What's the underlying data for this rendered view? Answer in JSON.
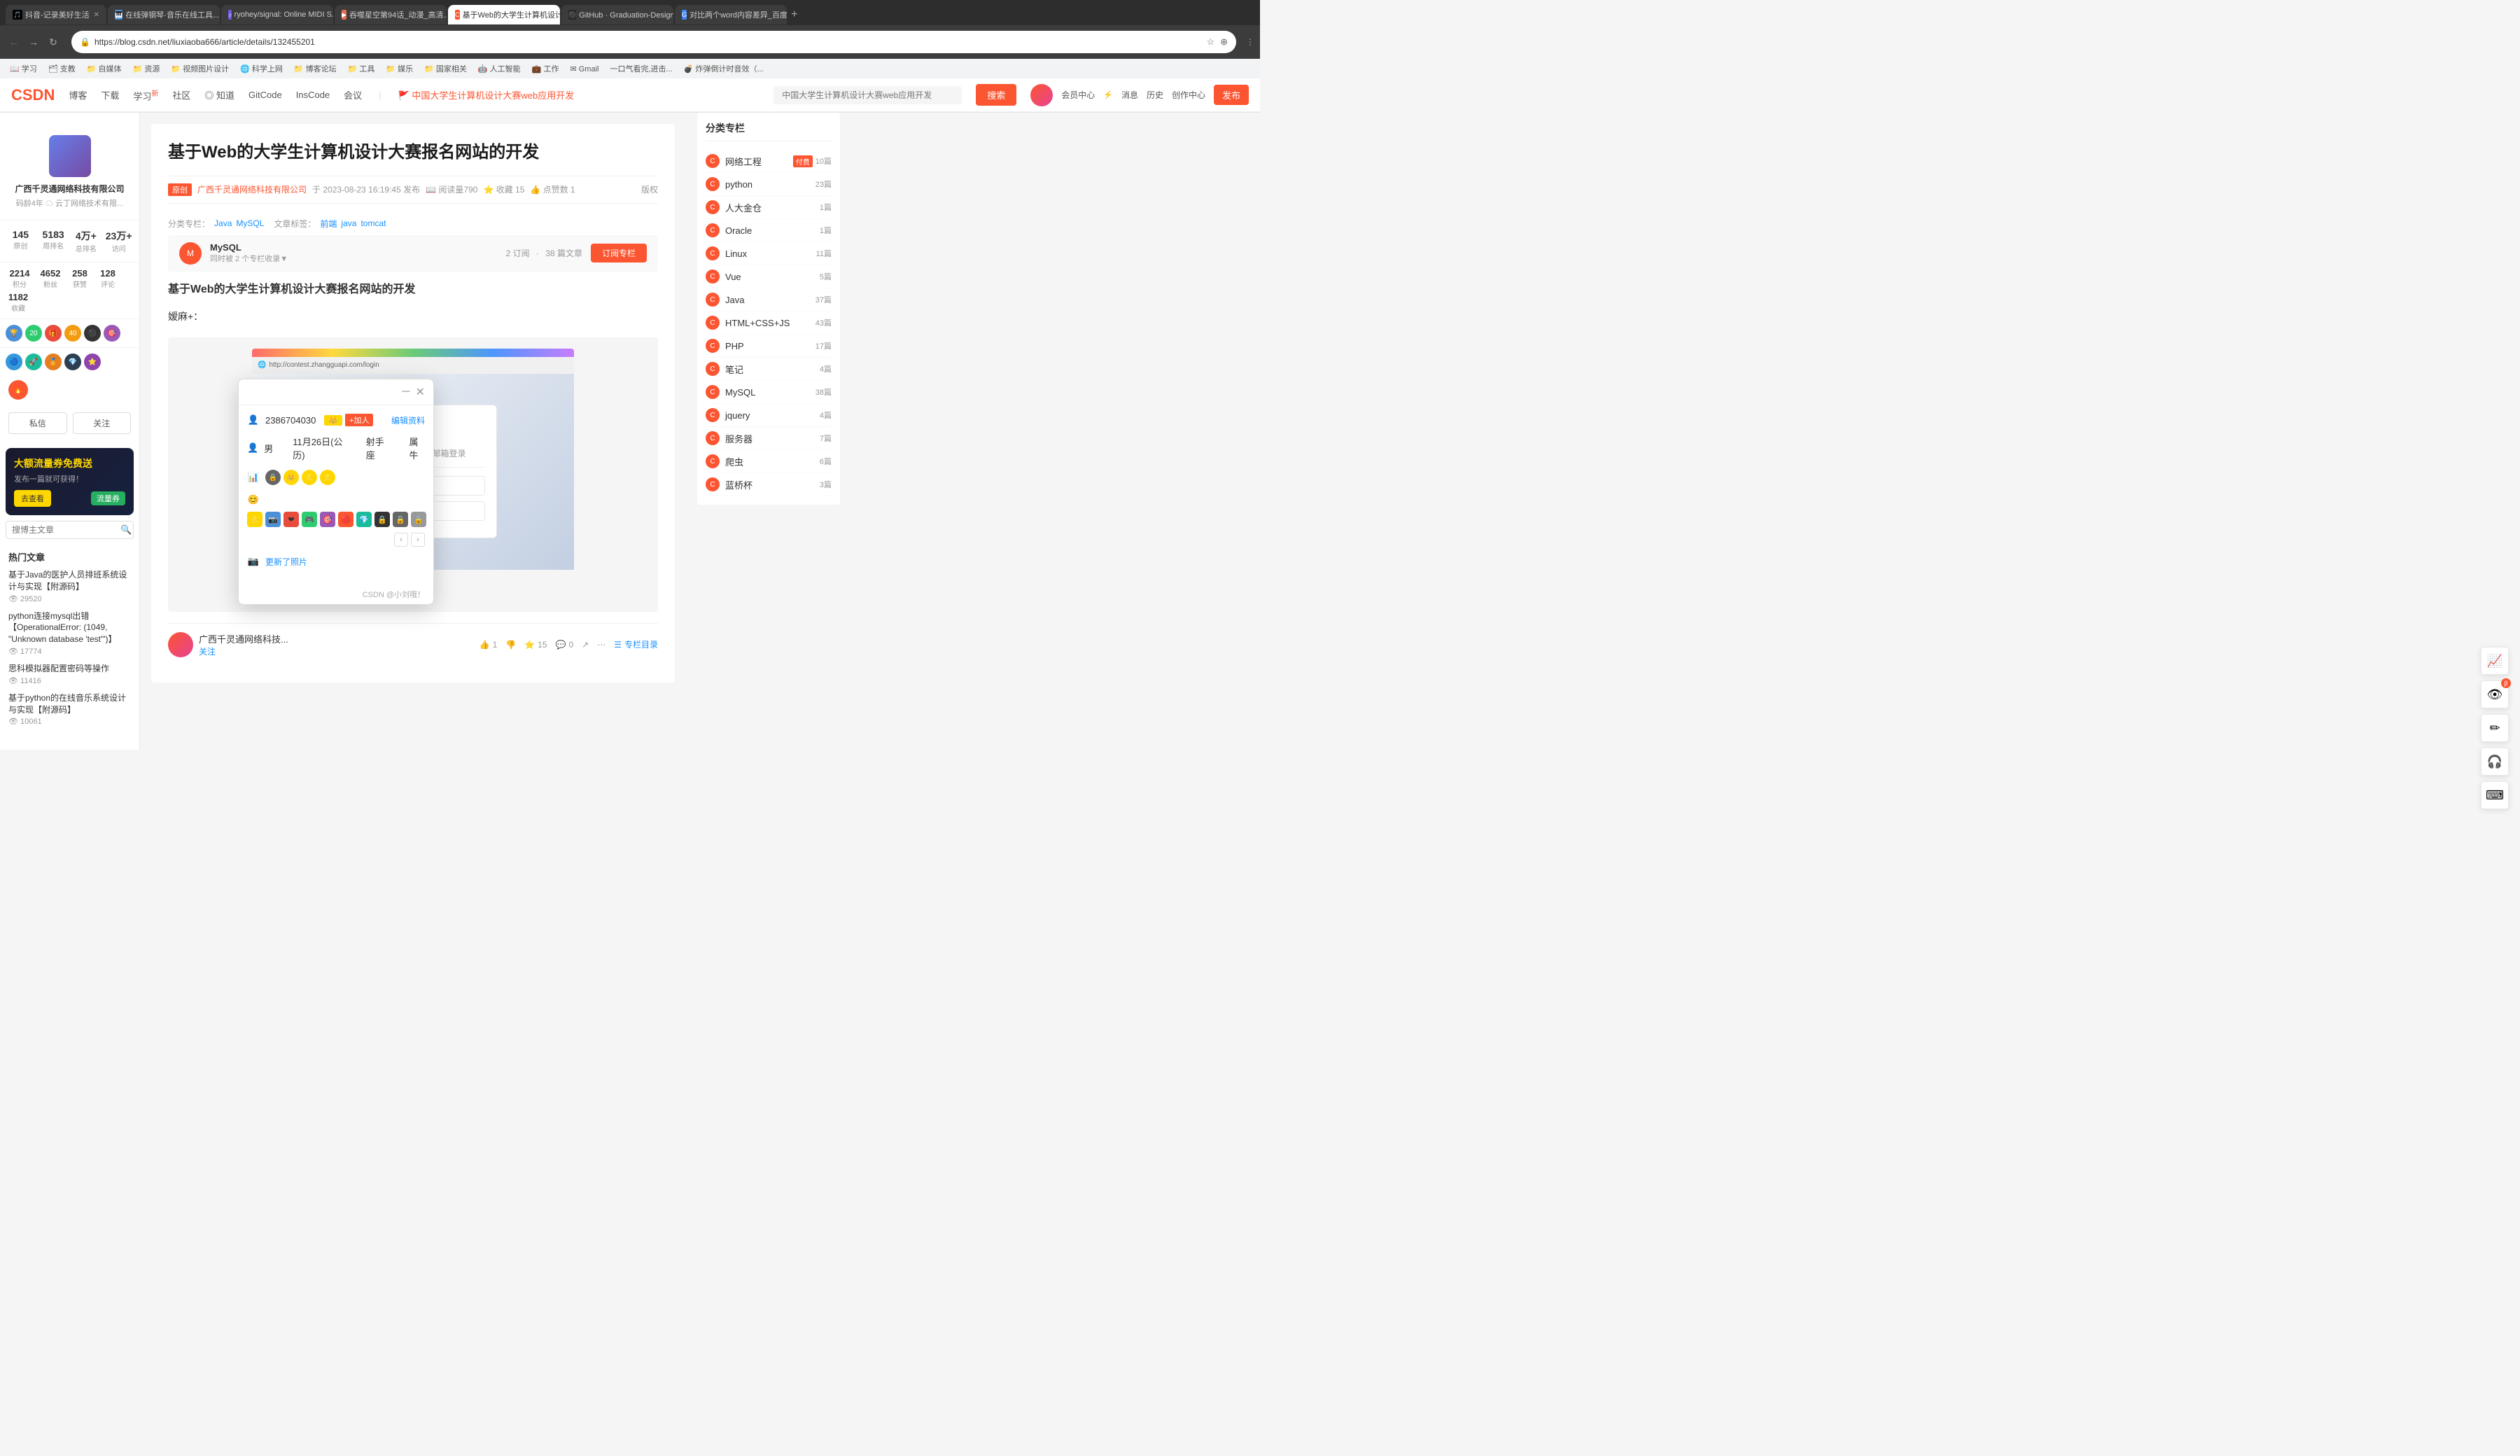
{
  "browser": {
    "url": "https://blog.csdn.net/liuxiaoba666/article/details/132455201",
    "tabs": [
      {
        "id": 1,
        "title": "抖音-记录美好生活",
        "active": false,
        "favicon": "🎵"
      },
      {
        "id": 2,
        "title": "在线弹钢琴·音乐在线工具...",
        "active": false,
        "favicon": "🎹"
      },
      {
        "id": 3,
        "title": "ryohey/signal: Online MIDI S...",
        "active": false,
        "favicon": "🎹"
      },
      {
        "id": 4,
        "title": "吞噬星空第94话_动漫_高清...",
        "active": false,
        "favicon": "▶"
      },
      {
        "id": 5,
        "title": "基于Web的大学生计算机设计...",
        "active": true,
        "favicon": "C"
      },
      {
        "id": 6,
        "title": "GitHub · Graduation-Design/文档/提...",
        "active": false,
        "favicon": "⚫"
      },
      {
        "id": 7,
        "title": "对比两个word内容差异_百度...",
        "active": false,
        "favicon": "🔍"
      }
    ],
    "bookmarks": [
      "学习",
      "支教",
      "自媒体",
      "资源",
      "视频图片设计",
      "科学上网",
      "博客论坛",
      "工具",
      "媒乐",
      "国家相关",
      "人工智能",
      "工作",
      "Gmail",
      "一口气看完,进击...",
      "炸弹倒计时音效（..."
    ]
  },
  "csdn": {
    "logo": "CSDN",
    "nav_items": [
      "博客",
      "下载",
      "学习",
      "社区",
      "◎ 知道",
      "GitCode",
      "InsCode",
      "会议"
    ],
    "search_placeholder": "中国大学生计算机设计大赛web应用开发",
    "search_btn": "搜索",
    "user_nav": [
      "会员中心",
      "消息",
      "历史",
      "创作中心"
    ],
    "publish_btn": "发布"
  },
  "left_sidebar": {
    "company": "广西千灵通网络科技有限公司",
    "sub_company": "码龄4年  ☁ 云丁网络技术有限...",
    "stats": [
      {
        "number": "145",
        "label": "原创"
      },
      {
        "number": "5183",
        "label": "周排名"
      },
      {
        "number": "4万+",
        "label": "总排名"
      },
      {
        "number": "23万+",
        "label": "访问"
      }
    ],
    "stats2": [
      {
        "number": "2214",
        "label": "积分"
      },
      {
        "number": "4652",
        "label": "粉丝"
      },
      {
        "number": "258",
        "label": "获赞"
      },
      {
        "number": "128",
        "label": "评论"
      },
      {
        "number": "1182",
        "label": "收藏"
      }
    ],
    "btn_msg": "私信",
    "btn_follow": "关注",
    "ad": {
      "title": "大额流量券免费送",
      "sub": "发布一篇就可获得！",
      "btn": "去查看",
      "badge": "流量券"
    },
    "search_placeholder": "搜博主文章",
    "hot_title": "热门文章",
    "hot_articles": [
      {
        "title": "基于Java的医护人员排班系统设计与实现【附源码】",
        "views": "29520"
      },
      {
        "title": "python连接mysql出错【OperationalError: (1049, \"Unknown database 'test'\")】",
        "views": "17774"
      },
      {
        "title": "思科模拟器配置密码等操作",
        "views": "11416"
      },
      {
        "title": "基于python的在线音乐系统设计与实现【附源码】",
        "views": "10061"
      }
    ]
  },
  "article": {
    "title": "基于Web的大学生计算机设计大赛报名网站的开发",
    "original_badge": "原创",
    "author": "广西千灵通网络科技有限公司",
    "time": "于 2023-08-23 16:19:45 发布",
    "views": "阅读量790",
    "collect": "收藏 15",
    "likes": "点赞数 1",
    "version": "版权",
    "category_label": "分类专栏：",
    "categories": [
      "Java",
      "MySQL"
    ],
    "tags_label": "文章标签：",
    "tags": [
      "前端",
      "java",
      "tomcat"
    ],
    "subscription": {
      "name": "MySQL",
      "desc": "同时被 2 个专栏收录▼",
      "orders": "2 订阅",
      "articles": "38 篇文章",
      "btn": "订阅专栏"
    },
    "body_title": "基于Web的大学生计算机设计大赛报名网站的开发",
    "body_intro": "嫒麻+：",
    "footer": {
      "author": "广西千灵通网络科技...",
      "follow": "关注",
      "like": "1",
      "dislike": "",
      "star": "15",
      "comment": "0",
      "share": ""
    }
  },
  "dialog": {
    "qq_number": "2386704030",
    "add_friend_btn": "+加人",
    "edit_profile": "编辑资料",
    "gender": "男",
    "birthday": "11月26日(公历)",
    "constellation": "射手座",
    "zodiac": "属牛",
    "update_photo": "更新了照片",
    "watermark": "CSDN @小刘哦！"
  },
  "right_sidebar": {
    "title": "分类专栏",
    "categories": [
      {
        "name": "网络工程",
        "count": "10篇",
        "badge": "付费"
      },
      {
        "name": "python",
        "count": "23篇"
      },
      {
        "name": "人大金仓",
        "count": "1篇"
      },
      {
        "name": "Oracle",
        "count": "1篇"
      },
      {
        "name": "Linux",
        "count": "11篇"
      },
      {
        "name": "Vue",
        "count": "5篇"
      },
      {
        "name": "Java",
        "count": "37篇"
      },
      {
        "name": "HTML+CSS+JS",
        "count": "43篇"
      },
      {
        "name": "PHP",
        "count": "17篇"
      },
      {
        "name": "笔记",
        "count": "4篇"
      },
      {
        "name": "MySQL",
        "count": "38篇"
      },
      {
        "name": "jquery",
        "count": "4篇"
      },
      {
        "name": "服务器",
        "count": "7篇"
      },
      {
        "name": "爬虫",
        "count": "6篇"
      },
      {
        "name": "蓝桥杯",
        "count": "3篇"
      }
    ]
  }
}
